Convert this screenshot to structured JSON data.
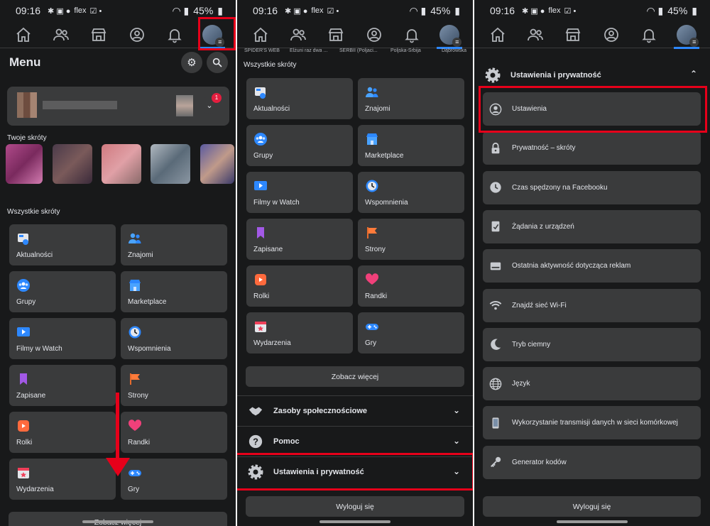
{
  "status": {
    "time": "09:16",
    "battery": "45%",
    "carrier_label": "flex"
  },
  "colors": {
    "background": "#18191a",
    "tile": "#3a3b3c",
    "accent": "#2d88ff",
    "highlight": "#e6001a"
  },
  "nav_icons": [
    "home-icon",
    "friends-icon",
    "marketplace-icon",
    "profile-icon",
    "bell-icon",
    "avatar-menu-icon"
  ],
  "panel1": {
    "title": "Menu",
    "notification_count": "1",
    "shortcuts_label": "Twoje skróty",
    "all_shortcuts_label": "Wszystkie skróty",
    "tiles": [
      {
        "label": "Aktualności",
        "icon": "news-feed-icon"
      },
      {
        "label": "Znajomi",
        "icon": "friends-icon"
      },
      {
        "label": "Grupy",
        "icon": "groups-icon"
      },
      {
        "label": "Marketplace",
        "icon": "marketplace-icon"
      },
      {
        "label": "Filmy w Watch",
        "icon": "watch-icon"
      },
      {
        "label": "Wspomnienia",
        "icon": "memories-icon"
      },
      {
        "label": "Zapisane",
        "icon": "saved-icon"
      },
      {
        "label": "Strony",
        "icon": "pages-icon"
      },
      {
        "label": "Rolki",
        "icon": "reels-icon"
      },
      {
        "label": "Randki",
        "icon": "dating-icon"
      },
      {
        "label": "Wydarzenia",
        "icon": "events-icon"
      },
      {
        "label": "Gry",
        "icon": "games-icon"
      }
    ],
    "see_more": "Zobacz więcej"
  },
  "panel2": {
    "strip": [
      "SPIDER'S WEB",
      "Elżuni raz dwa ...",
      "SERBII (Poljaci...",
      "Poljska-Srbija",
      "Dąbrowska"
    ],
    "all_shortcuts_label": "Wszystkie skróty",
    "tiles": [
      {
        "label": "Aktualności",
        "icon": "news-feed-icon"
      },
      {
        "label": "Znajomi",
        "icon": "friends-icon"
      },
      {
        "label": "Grupy",
        "icon": "groups-icon"
      },
      {
        "label": "Marketplace",
        "icon": "marketplace-icon"
      },
      {
        "label": "Filmy w Watch",
        "icon": "watch-icon"
      },
      {
        "label": "Wspomnienia",
        "icon": "memories-icon"
      },
      {
        "label": "Zapisane",
        "icon": "saved-icon"
      },
      {
        "label": "Strony",
        "icon": "pages-icon"
      },
      {
        "label": "Rolki",
        "icon": "reels-icon"
      },
      {
        "label": "Randki",
        "icon": "dating-icon"
      },
      {
        "label": "Wydarzenia",
        "icon": "events-icon"
      },
      {
        "label": "Gry",
        "icon": "games-icon"
      }
    ],
    "see_more": "Zobacz więcej",
    "community": "Zasoby społecznościowe",
    "help": "Pomoc",
    "settings_privacy": "Ustawienia i prywatność",
    "logout": "Wyloguj się"
  },
  "panel3": {
    "header": "Ustawienia i prywatność",
    "items": [
      {
        "label": "Ustawienia",
        "icon": "user-circle-icon"
      },
      {
        "label": "Prywatność – skróty",
        "icon": "lock-icon"
      },
      {
        "label": "Czas spędzony na Facebooku",
        "icon": "clock-icon"
      },
      {
        "label": "Żądania z urządzeń",
        "icon": "device-request-icon"
      },
      {
        "label": "Ostatnia aktywność dotycząca reklam",
        "icon": "ad-activity-icon"
      },
      {
        "label": "Znajdź sieć Wi-Fi",
        "icon": "wifi-icon"
      },
      {
        "label": "Tryb ciemny",
        "icon": "moon-icon"
      },
      {
        "label": "Język",
        "icon": "globe-icon"
      },
      {
        "label": "Wykorzystanie transmisji danych w sieci komórkowej",
        "icon": "phone-data-icon"
      },
      {
        "label": "Generator kodów",
        "icon": "key-icon"
      }
    ],
    "logout": "Wyloguj się"
  }
}
